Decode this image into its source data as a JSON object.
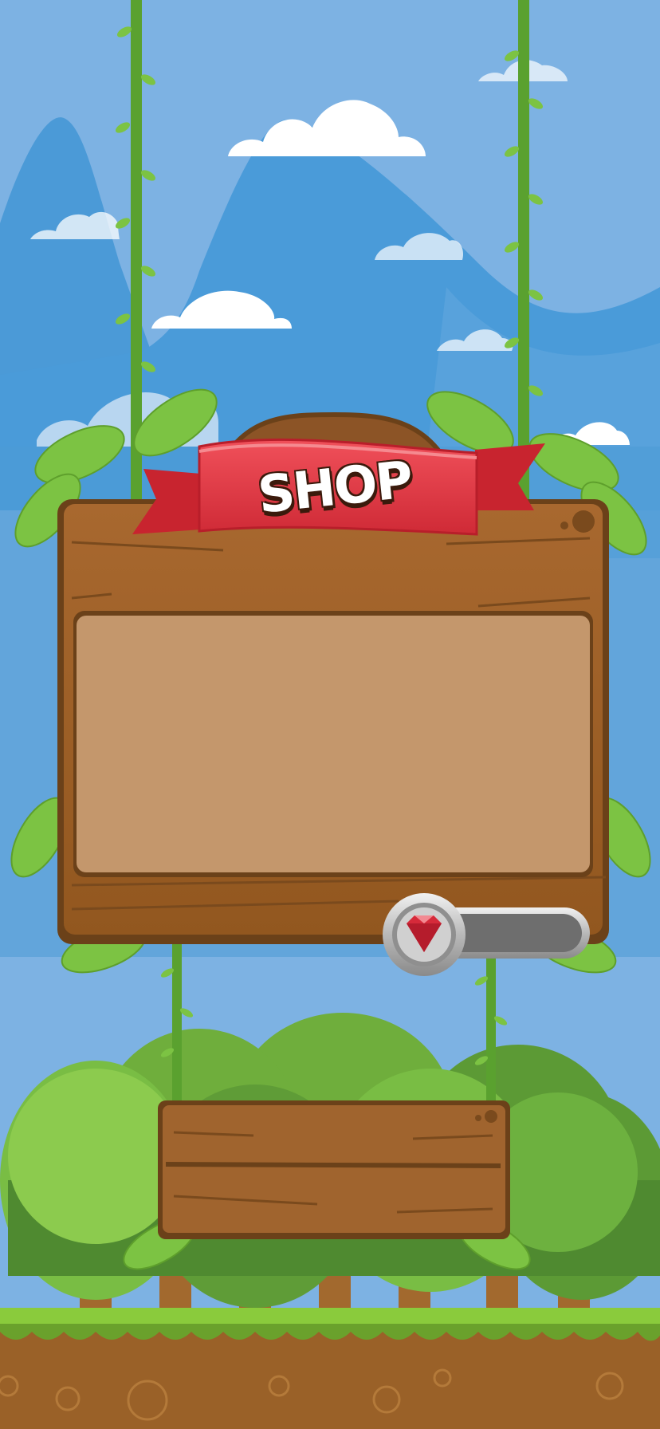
{
  "screen": {
    "title": "SHOP"
  },
  "gem_meter": {
    "icon": "ruby-gem-icon",
    "value": ""
  },
  "colors": {
    "sky": "#7db2e3",
    "mountain_far": "#4a9ad8",
    "mountain_near": "#5aa2db",
    "wood": "#a0642e",
    "wood_dark": "#6b4119",
    "wood_panel": "#c4976c",
    "ribbon": "#e23a45",
    "leaf": "#7cc343",
    "grass": "#8acb3c",
    "dirt": "#9a6128"
  }
}
